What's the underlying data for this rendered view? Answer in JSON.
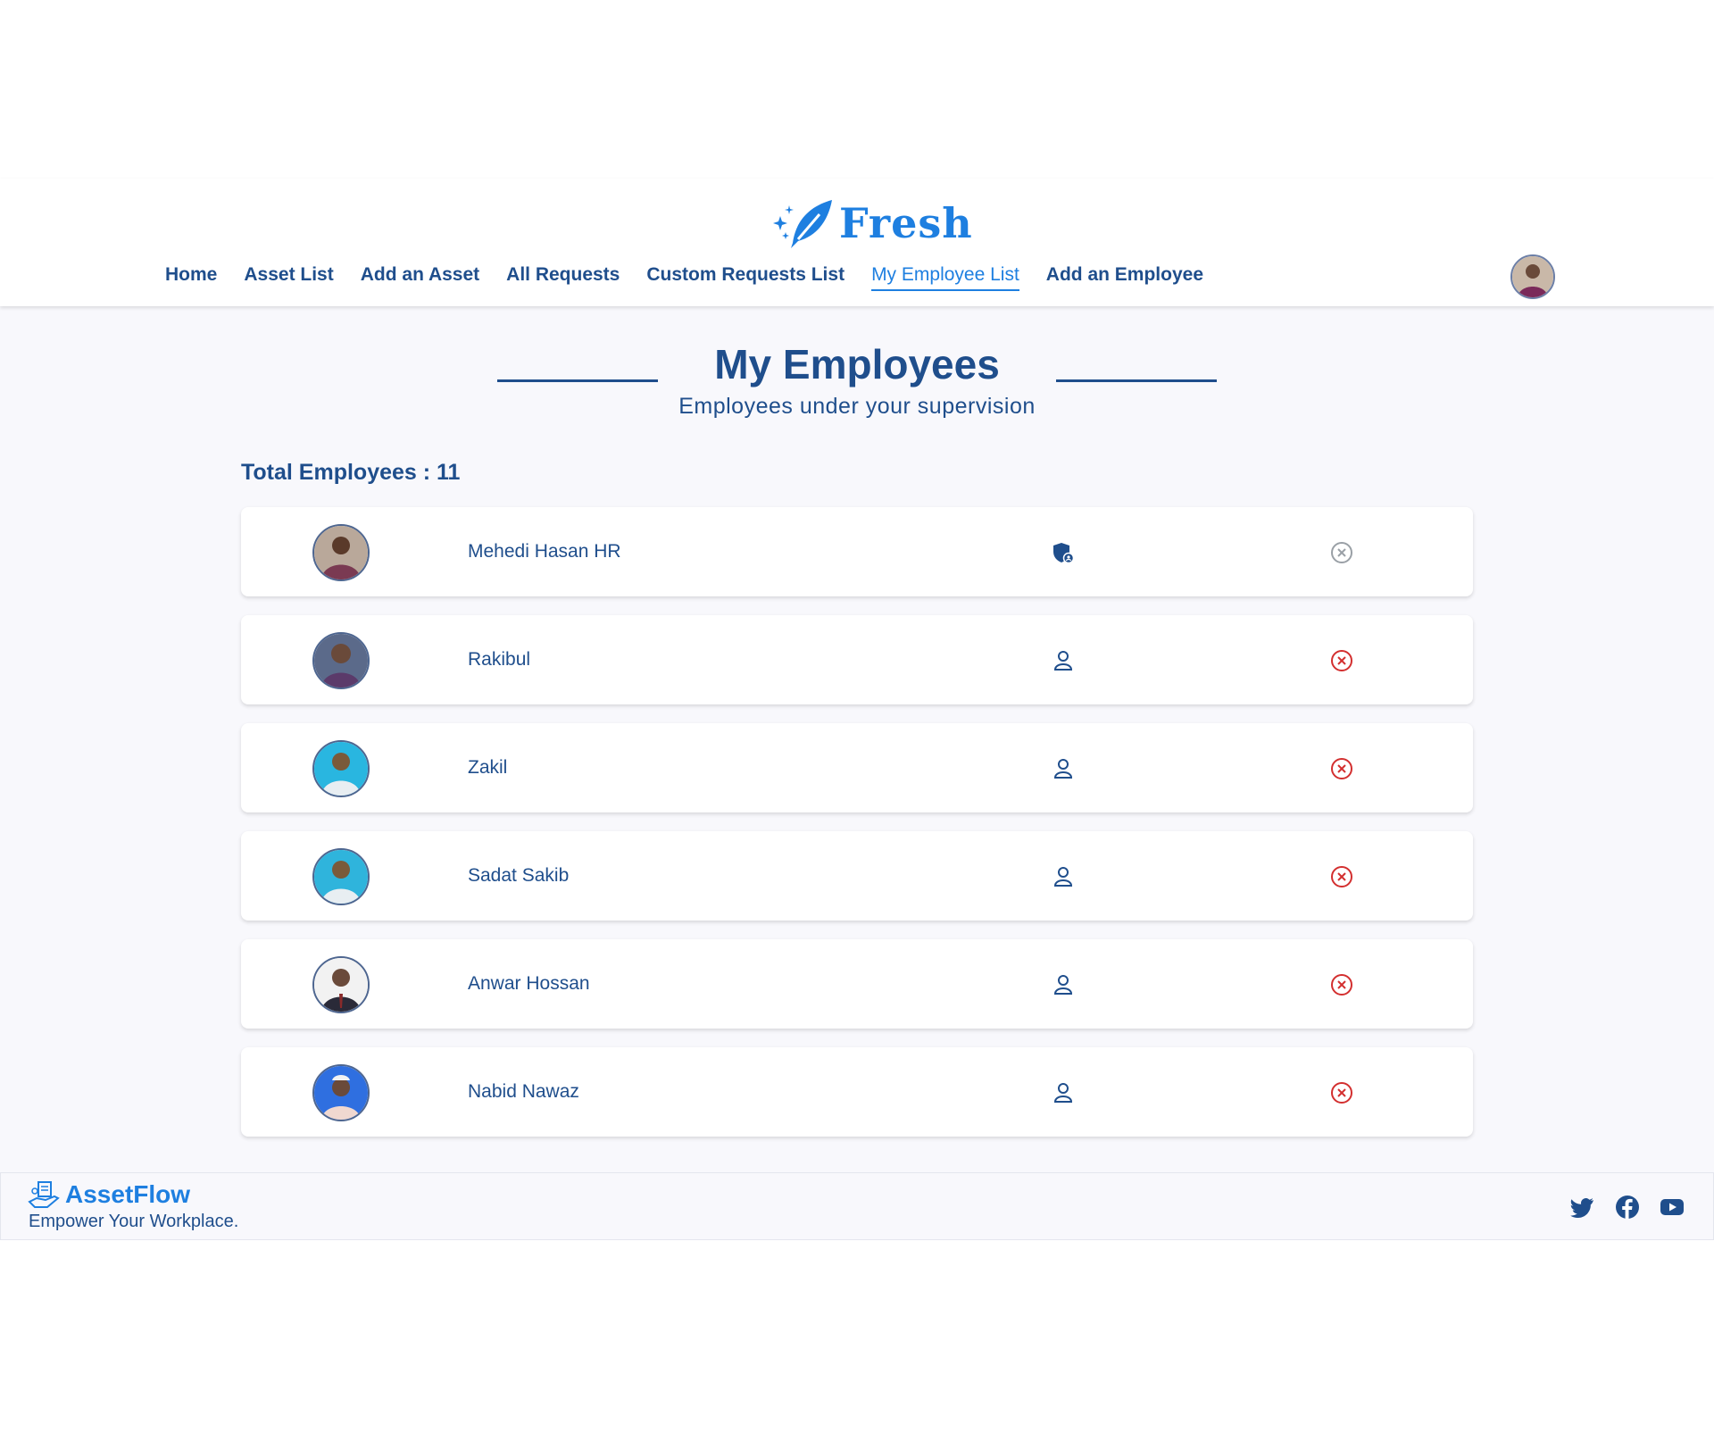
{
  "brand": {
    "name": "Fresh",
    "color": "#1e7fe0"
  },
  "nav": {
    "items": [
      {
        "label": "Home",
        "active": false
      },
      {
        "label": "Asset List",
        "active": false
      },
      {
        "label": "Add an Asset",
        "active": false
      },
      {
        "label": "All Requests",
        "active": false
      },
      {
        "label": "Custom Requests List",
        "active": false
      },
      {
        "label": "My Employee List",
        "active": true
      },
      {
        "label": "Add an Employee",
        "active": false
      }
    ]
  },
  "page": {
    "title": "My Employees",
    "subtitle": "Employees under your supervision",
    "total_label": "Total Employees : 11"
  },
  "employees": [
    {
      "name": "Mehedi Hasan HR",
      "role_icon": "admin-shield-icon",
      "remove_enabled": false,
      "avatar_bg": "#7a3a52"
    },
    {
      "name": "Rakibul",
      "role_icon": "user-icon",
      "remove_enabled": true,
      "avatar_bg": "#5b4a7a"
    },
    {
      "name": "Zakil",
      "role_icon": "user-icon",
      "remove_enabled": true,
      "avatar_bg": "#29b6e0"
    },
    {
      "name": "Sadat Sakib",
      "role_icon": "user-icon",
      "remove_enabled": true,
      "avatar_bg": "#2fb4dc"
    },
    {
      "name": "Anwar Hossan",
      "role_icon": "user-icon",
      "remove_enabled": true,
      "avatar_bg": "#2a2a38"
    },
    {
      "name": "Nabid Nawaz",
      "role_icon": "user-icon",
      "remove_enabled": true,
      "avatar_bg": "#2f6fe0"
    }
  ],
  "footer": {
    "brand": "AssetFlow",
    "tagline": "Empower Your Workplace.",
    "social": [
      "twitter-icon",
      "facebook-icon",
      "youtube-icon"
    ]
  },
  "colors": {
    "primary": "#1f4e8c",
    "accent": "#1e7fe0",
    "danger": "#d32f2f",
    "disabled": "#9aa0a6"
  }
}
